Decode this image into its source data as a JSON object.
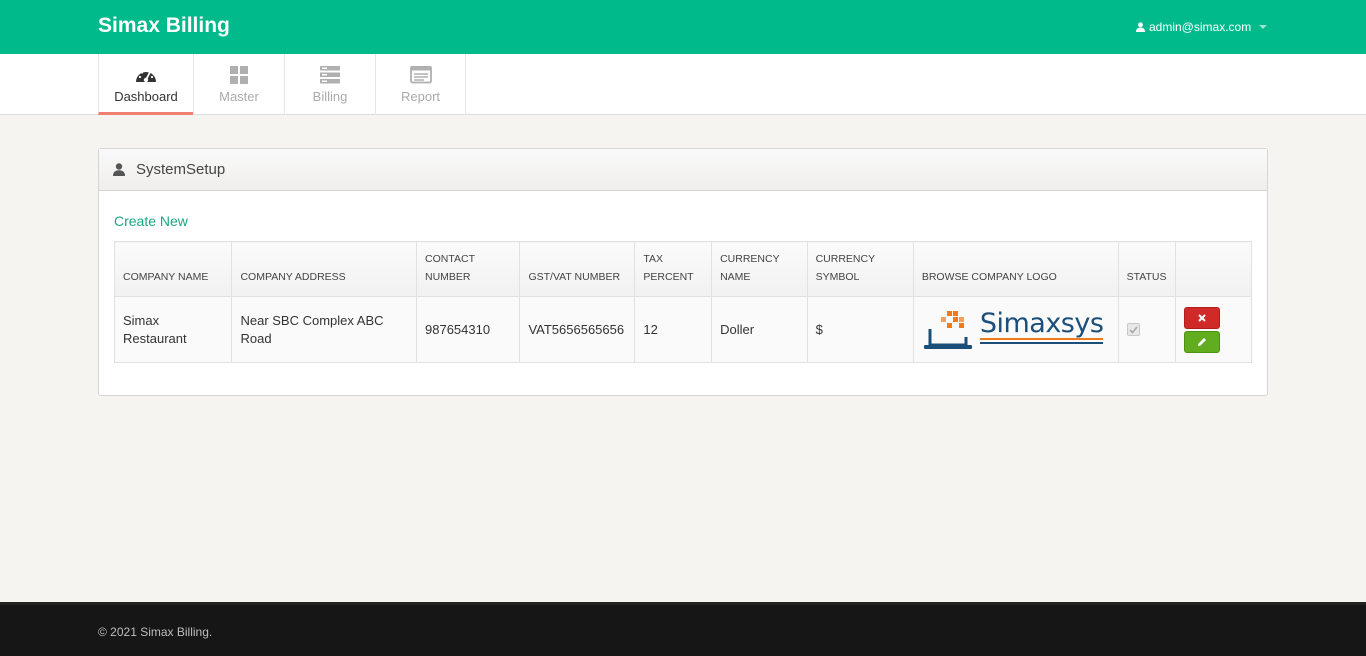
{
  "app": {
    "title": "Simax Billing"
  },
  "user": {
    "email": "admin@simax.com"
  },
  "nav": {
    "tabs": [
      {
        "label": "Dashboard",
        "icon": "dashboard-icon",
        "active": true
      },
      {
        "label": "Master",
        "icon": "grid-icon",
        "active": false
      },
      {
        "label": "Billing",
        "icon": "list-icon",
        "active": false
      },
      {
        "label": "Report",
        "icon": "report-icon",
        "active": false
      }
    ]
  },
  "widget": {
    "title": "SystemSetup",
    "create_new": "Create New"
  },
  "table": {
    "headers": [
      "COMPANY NAME",
      "COMPANY ADDRESS",
      "CONTACT NUMBER",
      "GST/VAT NUMBER",
      "TAX PERCENT",
      "CURRENCY NAME",
      "CURRENCY SYMBOL",
      "BROWSE COMPANY LOGO",
      "STATUS",
      ""
    ],
    "rows": [
      {
        "company_name": "Simax Restaurant",
        "company_address": "Near SBC Complex ABC Road",
        "contact_number": "987654310",
        "gst_vat_number": "VAT5656565656",
        "tax_percent": "12",
        "currency_name": "Doller",
        "currency_symbol": "$",
        "logo_text": "Simaxsys",
        "status_checked": true
      }
    ]
  },
  "footer": {
    "text": "© 2021 Simax Billing."
  },
  "colors": {
    "brand": "#00ba8b",
    "accent": "#f08070",
    "link": "#19a883",
    "danger": "#cf2a27",
    "success": "#62ac1f"
  }
}
